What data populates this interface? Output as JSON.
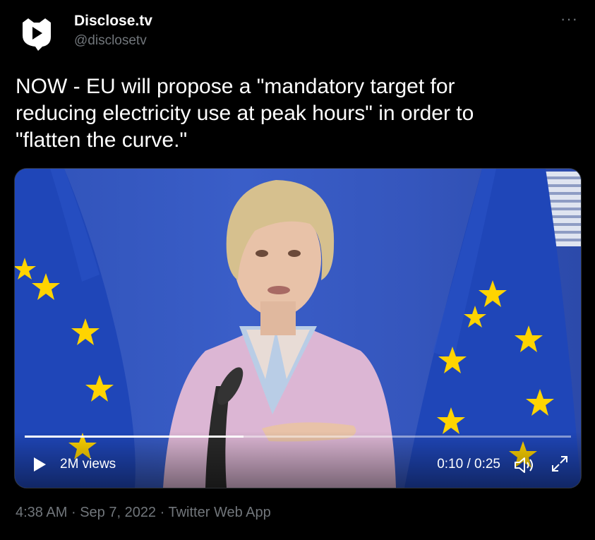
{
  "account": {
    "name": "Disclose.tv",
    "handle": "@disclosetv"
  },
  "tweet": {
    "text": "NOW - EU will propose a \"mandatory target for\nreducing electricity use at peak hours\" in order to\n\"flatten the curve.\"",
    "time": "4:38 AM",
    "date": "Sep 7, 2022",
    "source": "Twitter Web App",
    "separator": "·"
  },
  "video": {
    "views": "2M views",
    "time_display": "0:10 / 0:25",
    "progress_fraction": 0.4
  },
  "colors": {
    "background": "#000000",
    "text": "#ffffff",
    "muted": "#71767b",
    "eu_blue": "#2f54c4",
    "eu_star": "#ffdd00"
  },
  "icons": [
    "more-icon",
    "play-icon",
    "volume-icon",
    "fullscreen-icon",
    "avatar-logo-icon"
  ]
}
